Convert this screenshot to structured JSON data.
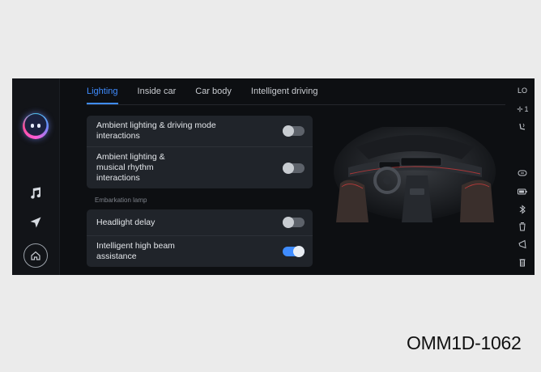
{
  "tabs": [
    {
      "label": "Lighting",
      "active": true
    },
    {
      "label": "Inside car",
      "active": false
    },
    {
      "label": "Car body",
      "active": false
    },
    {
      "label": "Intelligent driving",
      "active": false
    }
  ],
  "group1": [
    {
      "label": "Ambient lighting & driving mode interactions",
      "on": false
    },
    {
      "label": "Ambient lighting & musical rhythm interactions",
      "on": false
    }
  ],
  "section_label": "Embarkation lamp",
  "group2": [
    {
      "label": "Headlight delay",
      "on": false
    },
    {
      "label": "Intelligent high beam assistance",
      "on": true
    }
  ],
  "right_rail": {
    "temp_label": "LO",
    "fan_label": "1"
  },
  "caption": "OMM1D-1062",
  "colors": {
    "accent": "#3f8cff",
    "panel": "#20242a",
    "screen_bg": "#0d0f12"
  },
  "icons": {
    "left_rail": [
      "assistant-avatar-icon",
      "music-icon",
      "navigation-icon",
      "home-icon"
    ],
    "right_rail": [
      "fan-icon",
      "seat-airflow-icon",
      "recirculation-icon",
      "battery-icon",
      "bluetooth-icon",
      "cup-icon",
      "horn-icon",
      "trash-icon"
    ]
  }
}
